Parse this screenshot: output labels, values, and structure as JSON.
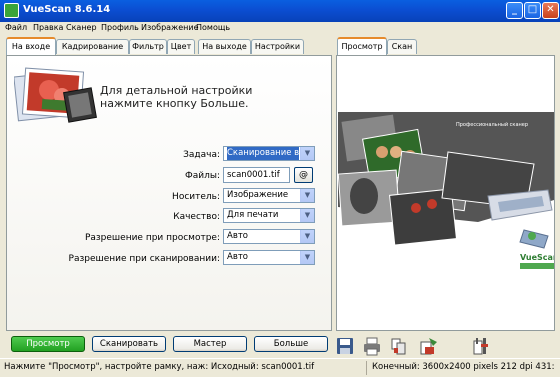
{
  "window": {
    "title": "VueScan 8.6.14",
    "minimize": "_",
    "maximize": "□",
    "close": "✕"
  },
  "menu": [
    "Файл",
    "Правка",
    "Сканер",
    "Профиль",
    "Изображение",
    "Помощь"
  ],
  "left_tabs": [
    "На входе",
    "Кадрирование",
    "Фильтр",
    "Цвет",
    "На выходе",
    "Настройки"
  ],
  "active_left_tab": "На входе",
  "right_tabs": [
    "Просмотр",
    "Скан"
  ],
  "active_right_tab": "Просмотр",
  "hint": {
    "line1": "Для детальной настройки",
    "line2": "нажмите кнопку Больше."
  },
  "form": {
    "task_label": "Задача:",
    "task_value": "Сканирование в ф",
    "files_label": "Файлы:",
    "files_value": "scan0001.tif",
    "files_button": "@",
    "media_label": "Носитель:",
    "media_value": "Изображение",
    "quality_label": "Качество:",
    "quality_value": "Для печати",
    "preview_res_label": "Разрешение при просмотре:",
    "preview_res_value": "Авто",
    "scan_res_label": "Разрешение при сканировании:",
    "scan_res_value": "Авто"
  },
  "preview": {
    "caption": "Профессиональный сканер",
    "brand": "VueScan",
    "icon": "vuescan-logo-icon"
  },
  "buttons": {
    "preview": "Просмотр",
    "scan": "Сканировать",
    "wizard": "Мастер",
    "more": "Больше"
  },
  "toolbar_icons": [
    "save-icon",
    "print-icon",
    "copy-icon",
    "email-icon",
    "settings-icon"
  ],
  "status": {
    "left": "Нажмите \"Просмотр\", настройте рамку, наж: Исходный: scan0001.tif",
    "right": "Конечный: 3600x2400 pixels 212 dpi 431:"
  },
  "colors": {
    "titlebar": "#0B4ED2",
    "accent_tab": "#E68B2C",
    "primary_button": "#22A022",
    "selection": "#316AC5"
  }
}
